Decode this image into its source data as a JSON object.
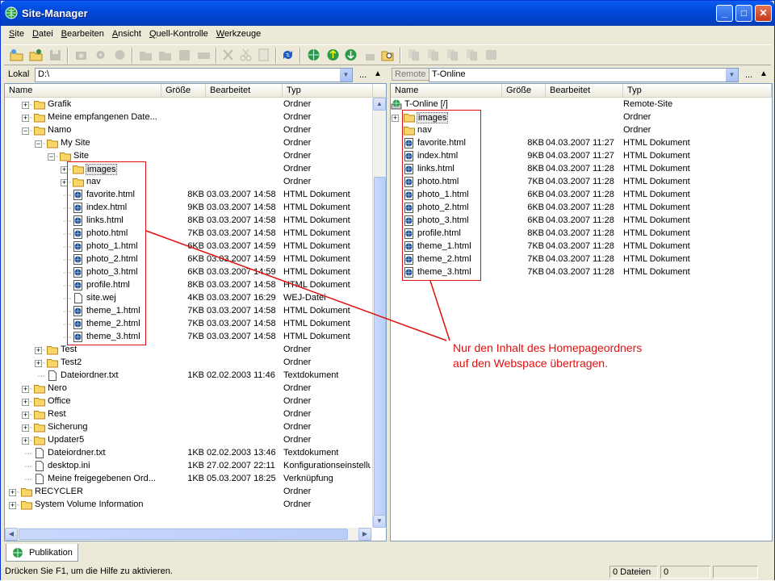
{
  "window": {
    "title": "Site-Manager"
  },
  "menu": [
    "Site",
    "Datei",
    "Bearbeiten",
    "Ansicht",
    "Quell-Kontrolle",
    "Werkzeuge"
  ],
  "local": {
    "label": "Lokal",
    "path": "D:\\",
    "more": "...",
    "columns": [
      "Name",
      "Größe",
      "Bearbeitet",
      "Typ"
    ],
    "rows": [
      {
        "level": 1,
        "icon": "folder",
        "expander": "+",
        "name": "Grafik",
        "size": "",
        "date": "",
        "type": "Ordner"
      },
      {
        "level": 1,
        "icon": "folder",
        "expander": "+",
        "name": "Meine empfangenen Date...",
        "size": "",
        "date": "",
        "type": "Ordner"
      },
      {
        "level": 1,
        "icon": "folder",
        "expander": "-",
        "name": "Namo",
        "size": "",
        "date": "",
        "type": "Ordner"
      },
      {
        "level": 2,
        "icon": "folder",
        "expander": "-",
        "name": "My Site",
        "size": "",
        "date": "",
        "type": "Ordner"
      },
      {
        "level": 3,
        "icon": "folder",
        "expander": "-",
        "name": "Site",
        "size": "",
        "date": "",
        "type": "Ordner"
      },
      {
        "level": 4,
        "icon": "folder",
        "expander": "+",
        "name": "images",
        "size": "",
        "date": "",
        "type": "Ordner",
        "selected": true
      },
      {
        "level": 4,
        "icon": "folder",
        "expander": "+",
        "name": "nav",
        "size": "",
        "date": "",
        "type": "Ordner"
      },
      {
        "level": 4,
        "icon": "html",
        "name": "favorite.html",
        "size": "8KB",
        "date": "03.03.2007 14:58",
        "type": "HTML Dokument"
      },
      {
        "level": 4,
        "icon": "html",
        "name": "index.html",
        "size": "9KB",
        "date": "03.03.2007 14:58",
        "type": "HTML Dokument"
      },
      {
        "level": 4,
        "icon": "html",
        "name": "links.html",
        "size": "8KB",
        "date": "03.03.2007 14:58",
        "type": "HTML Dokument"
      },
      {
        "level": 4,
        "icon": "html",
        "name": "photo.html",
        "size": "7KB",
        "date": "03.03.2007 14:58",
        "type": "HTML Dokument"
      },
      {
        "level": 4,
        "icon": "html",
        "name": "photo_1.html",
        "size": "6KB",
        "date": "03.03.2007 14:59",
        "type": "HTML Dokument"
      },
      {
        "level": 4,
        "icon": "html",
        "name": "photo_2.html",
        "size": "6KB",
        "date": "03.03.2007 14:59",
        "type": "HTML Dokument"
      },
      {
        "level": 4,
        "icon": "html",
        "name": "photo_3.html",
        "size": "6KB",
        "date": "03.03.2007 14:59",
        "type": "HTML Dokument"
      },
      {
        "level": 4,
        "icon": "html",
        "name": "profile.html",
        "size": "8KB",
        "date": "03.03.2007 14:58",
        "type": "HTML Dokument"
      },
      {
        "level": 4,
        "icon": "file",
        "name": "site.wej",
        "size": "4KB",
        "date": "03.03.2007 16:29",
        "type": "WEJ-Datei"
      },
      {
        "level": 4,
        "icon": "html",
        "name": "theme_1.html",
        "size": "7KB",
        "date": "03.03.2007 14:58",
        "type": "HTML Dokument"
      },
      {
        "level": 4,
        "icon": "html",
        "name": "theme_2.html",
        "size": "7KB",
        "date": "03.03.2007 14:58",
        "type": "HTML Dokument"
      },
      {
        "level": 4,
        "icon": "html",
        "name": "theme_3.html",
        "size": "7KB",
        "date": "03.03.2007 14:58",
        "type": "HTML Dokument"
      },
      {
        "level": 2,
        "icon": "folder",
        "expander": "+",
        "name": "Test",
        "size": "",
        "date": "",
        "type": "Ordner"
      },
      {
        "level": 2,
        "icon": "folder",
        "expander": "+",
        "name": "Test2",
        "size": "",
        "date": "",
        "type": "Ordner"
      },
      {
        "level": 2,
        "icon": "file",
        "name": "Dateiordner.txt",
        "size": "1KB",
        "date": "02.02.2003 11:46",
        "type": "Textdokument"
      },
      {
        "level": 1,
        "icon": "folder",
        "expander": "+",
        "name": "Nero",
        "size": "",
        "date": "",
        "type": "Ordner"
      },
      {
        "level": 1,
        "icon": "folder",
        "expander": "+",
        "name": "Office",
        "size": "",
        "date": "",
        "type": "Ordner"
      },
      {
        "level": 1,
        "icon": "folder",
        "expander": "+",
        "name": "Rest",
        "size": "",
        "date": "",
        "type": "Ordner"
      },
      {
        "level": 1,
        "icon": "folder",
        "expander": "+",
        "name": "Sicherung",
        "size": "",
        "date": "",
        "type": "Ordner"
      },
      {
        "level": 1,
        "icon": "folder",
        "expander": "+",
        "name": "Updater5",
        "size": "",
        "date": "",
        "type": "Ordner"
      },
      {
        "level": 1,
        "icon": "file",
        "name": "Dateiordner.txt",
        "size": "1KB",
        "date": "02.02.2003 13:46",
        "type": "Textdokument"
      },
      {
        "level": 1,
        "icon": "file",
        "name": "desktop.ini",
        "size": "1KB",
        "date": "27.02.2007 22:11",
        "type": "Konfigurationseinstellun"
      },
      {
        "level": 1,
        "icon": "file",
        "name": "Meine freigegebenen Ord...",
        "size": "1KB",
        "date": "05.03.2007 18:25",
        "type": "Verknüpfung"
      },
      {
        "level": 0,
        "icon": "folder",
        "expander": "+",
        "name": "RECYCLER",
        "size": "",
        "date": "",
        "type": "Ordner"
      },
      {
        "level": 0,
        "icon": "folder",
        "expander": "+",
        "name": "System Volume Information",
        "size": "",
        "date": "",
        "type": "Ordner"
      }
    ]
  },
  "remote": {
    "label": "Remote",
    "site": "T-Online",
    "more": "...",
    "columns": [
      "Name",
      "Größe",
      "Bearbeitet",
      "Typ"
    ],
    "rows": [
      {
        "level": 0,
        "icon": "globe",
        "name": "T-Online [/]",
        "size": "",
        "date": "",
        "type": "Remote-Site"
      },
      {
        "level": 1,
        "icon": "folder",
        "expander": "+",
        "name": "images",
        "size": "",
        "date": "",
        "type": "Ordner",
        "selected": true
      },
      {
        "level": 1,
        "icon": "folder",
        "name": "nav",
        "size": "",
        "date": "",
        "type": "Ordner"
      },
      {
        "level": 1,
        "icon": "html",
        "name": "favorite.html",
        "size": "8KB",
        "date": "04.03.2007 11:27",
        "type": "HTML Dokument"
      },
      {
        "level": 1,
        "icon": "html",
        "name": "index.html",
        "size": "9KB",
        "date": "04.03.2007 11:27",
        "type": "HTML Dokument"
      },
      {
        "level": 1,
        "icon": "html",
        "name": "links.html",
        "size": "8KB",
        "date": "04.03.2007 11:28",
        "type": "HTML Dokument"
      },
      {
        "level": 1,
        "icon": "html",
        "name": "photo.html",
        "size": "7KB",
        "date": "04.03.2007 11:28",
        "type": "HTML Dokument"
      },
      {
        "level": 1,
        "icon": "html",
        "name": "photo_1.html",
        "size": "6KB",
        "date": "04.03.2007 11:28",
        "type": "HTML Dokument"
      },
      {
        "level": 1,
        "icon": "html",
        "name": "photo_2.html",
        "size": "6KB",
        "date": "04.03.2007 11:28",
        "type": "HTML Dokument"
      },
      {
        "level": 1,
        "icon": "html",
        "name": "photo_3.html",
        "size": "6KB",
        "date": "04.03.2007 11:28",
        "type": "HTML Dokument"
      },
      {
        "level": 1,
        "icon": "html",
        "name": "profile.html",
        "size": "8KB",
        "date": "04.03.2007 11:28",
        "type": "HTML Dokument"
      },
      {
        "level": 1,
        "icon": "html",
        "name": "theme_1.html",
        "size": "7KB",
        "date": "04.03.2007 11:28",
        "type": "HTML Dokument"
      },
      {
        "level": 1,
        "icon": "html",
        "name": "theme_2.html",
        "size": "7KB",
        "date": "04.03.2007 11:28",
        "type": "HTML Dokument"
      },
      {
        "level": 1,
        "icon": "html",
        "name": "theme_3.html",
        "size": "7KB",
        "date": "04.03.2007 11:28",
        "type": "HTML Dokument"
      }
    ]
  },
  "annotation": [
    "Nur den Inhalt des Homepageordners",
    "auf den Webspace übertragen."
  ],
  "tab": {
    "label": "Publikation"
  },
  "status": {
    "help": "Drücken Sie F1, um die Hilfe zu aktivieren.",
    "files": "0 Dateien",
    "count": "0"
  },
  "colors": {
    "accent_red": "#e01010",
    "titlebar": "#0149d9"
  }
}
